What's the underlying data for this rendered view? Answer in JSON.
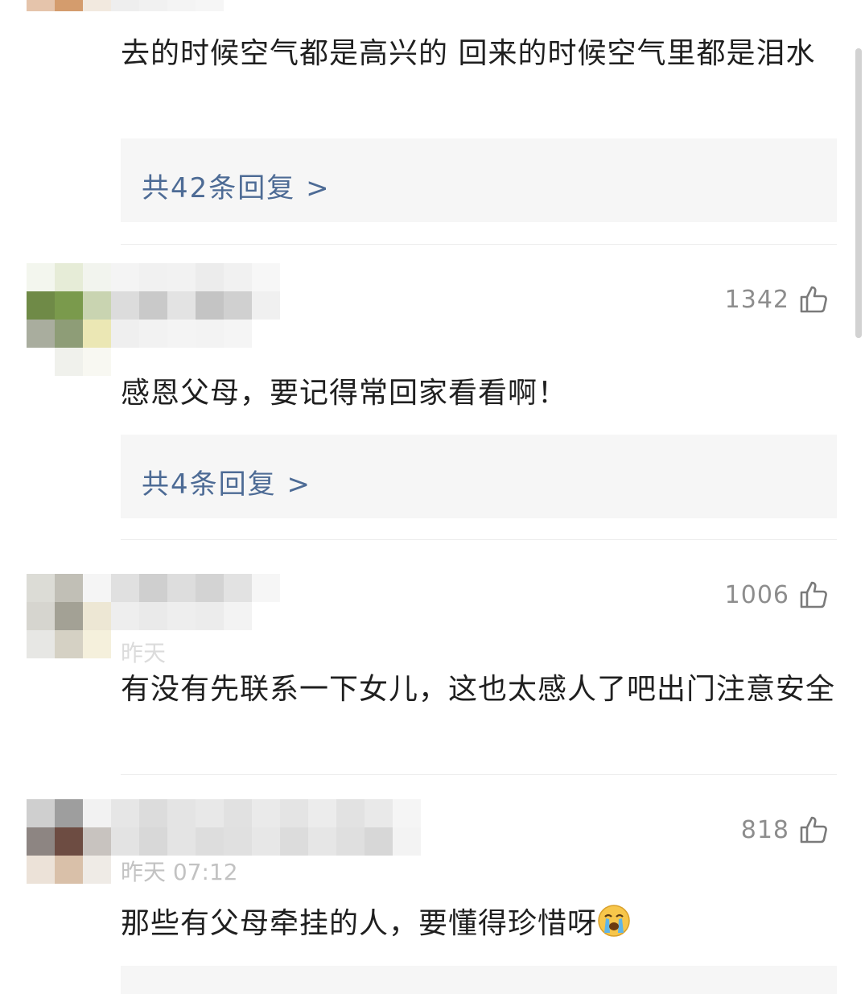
{
  "comments": [
    {
      "text": "去的时候空气都是高兴的 回来的时候空气里都是泪水",
      "reply_label": "共42条回复 >"
    },
    {
      "likes": "1342",
      "text": "感恩父母，要记得常回家看看啊！",
      "reply_label": "共4条回复 >"
    },
    {
      "likes": "1006",
      "time": "昨天",
      "text": "有没有先联系一下女儿，这也太感人了吧出门注意安全"
    },
    {
      "likes": "818",
      "time": "昨天 07:12",
      "text": "那些有父母牵挂的人，要懂得珍惜呀"
    }
  ],
  "icons": {
    "like": "thumbs-up-icon",
    "emoji": "crying-face-icon"
  },
  "colors": {
    "link": "#4d6b95",
    "like_count": "#8d8d8d",
    "reply_bg": "#f6f6f6"
  }
}
